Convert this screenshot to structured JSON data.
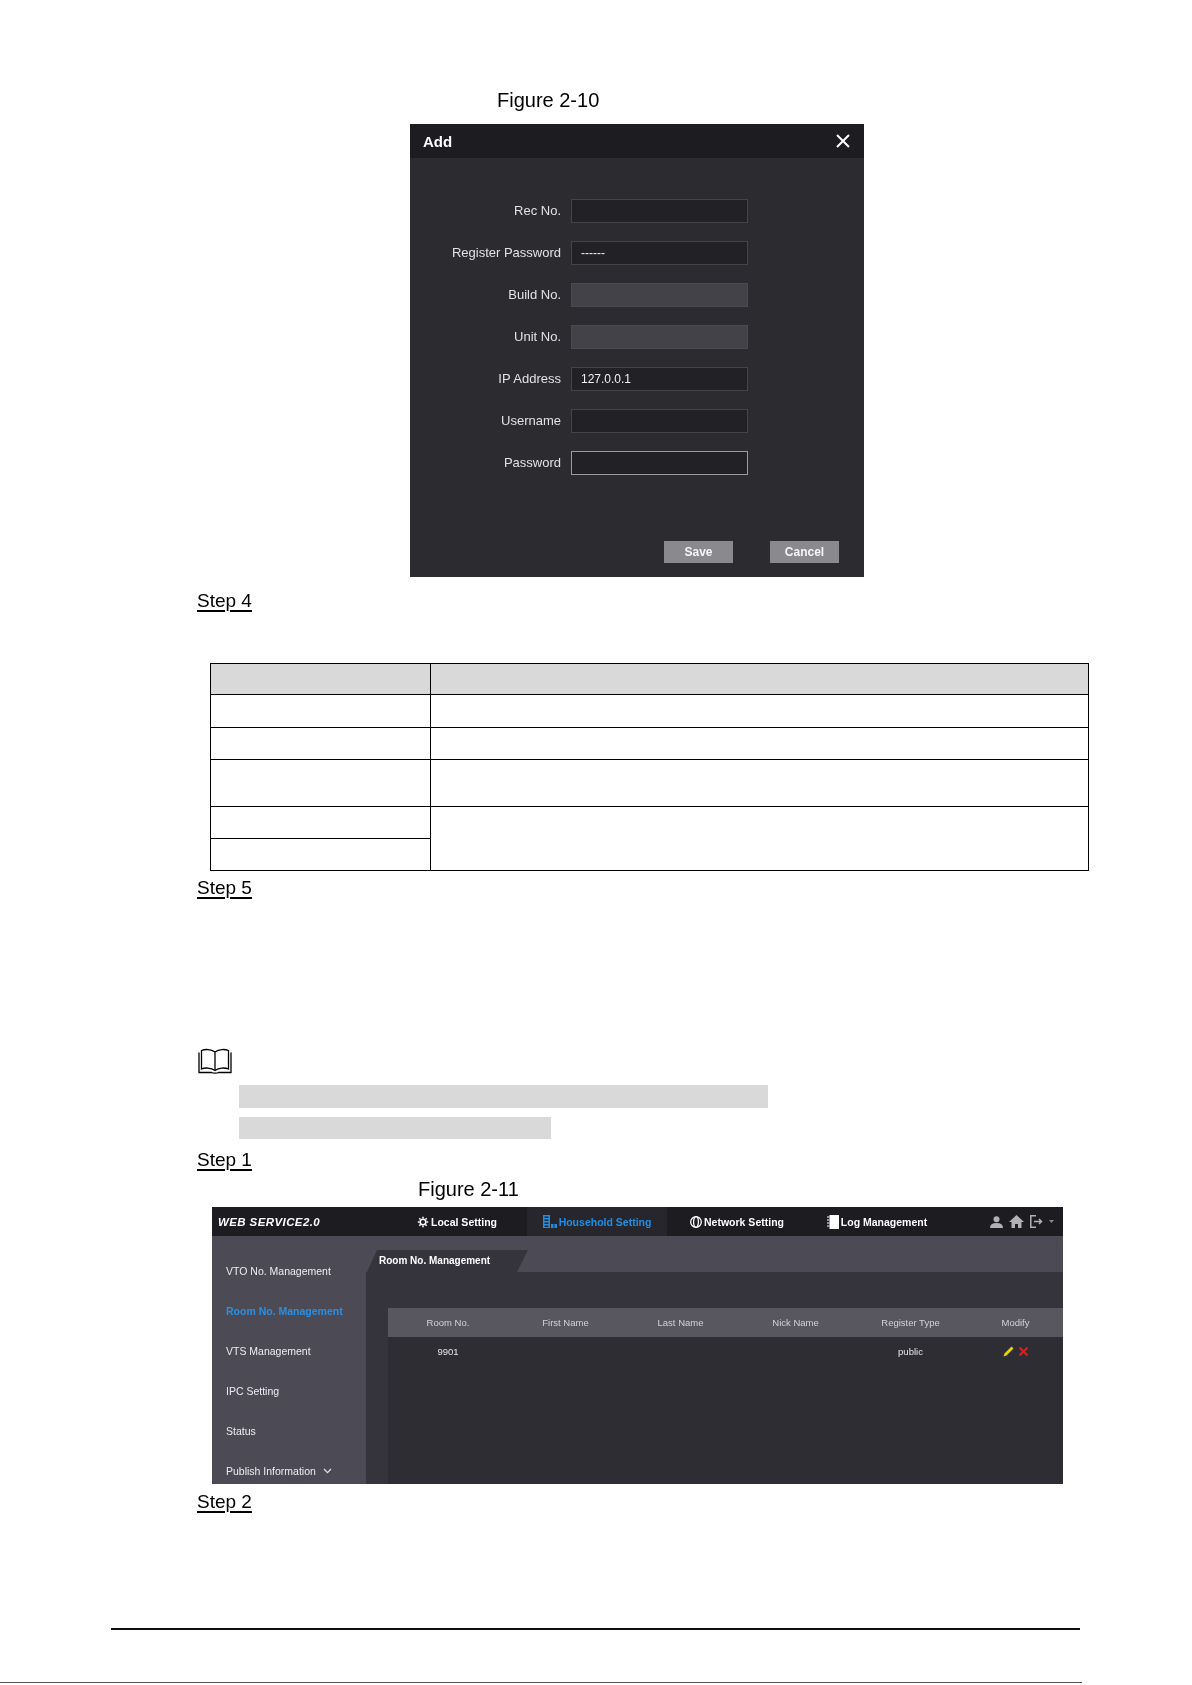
{
  "figure_2_10": {
    "caption": "Figure 2-10",
    "dialog": {
      "title": "Add",
      "fields": [
        {
          "label": "Rec No.",
          "disabled": false,
          "focused": false
        },
        {
          "label": "Register Password",
          "value": "------",
          "disabled": false,
          "focused": false
        },
        {
          "label": "Build No.",
          "disabled": true,
          "focused": false
        },
        {
          "label": "Unit No.",
          "disabled": true,
          "focused": false
        },
        {
          "label": "IP Address",
          "value": "127.0.0.1",
          "disabled": false,
          "focused": false
        },
        {
          "label": "Username",
          "disabled": false,
          "focused": false
        },
        {
          "label": "Password",
          "disabled": false,
          "focused": true
        }
      ],
      "buttons": [
        "Save",
        "Cancel"
      ]
    }
  },
  "step_4": "Step 4",
  "step_5": "Step 5",
  "step_1": "Step 1",
  "figure_2_11": {
    "caption": "Figure 2-11",
    "app": {
      "logo": "WEB SERVICE2.0",
      "menu": [
        {
          "label": "Local Setting",
          "selected": false
        },
        {
          "label": "Household Setting",
          "selected": true
        },
        {
          "label": "Network Setting",
          "selected": false
        },
        {
          "label": "Log Management",
          "selected": false
        }
      ],
      "sidebar": [
        {
          "label": "VTO No. Management",
          "kind": "link",
          "selected": false
        },
        {
          "label": "Room No. Management",
          "kind": "link",
          "selected": true
        },
        {
          "label": "VTS Management",
          "kind": "link",
          "selected": false
        },
        {
          "label": "IPC Setting",
          "kind": "link",
          "selected": false
        },
        {
          "label": "Status",
          "kind": "link",
          "selected": false
        },
        {
          "label": "Publish Information",
          "kind": "group",
          "selected": false
        }
      ],
      "tab": "Room No. Management",
      "table": {
        "columns": [
          "Room No.",
          "First Name",
          "Last Name",
          "Nick Name",
          "Register Type",
          "Modify"
        ],
        "rows": [
          {
            "room_no": "9901",
            "register_type": "public"
          }
        ]
      }
    }
  },
  "step_2": "Step 2"
}
